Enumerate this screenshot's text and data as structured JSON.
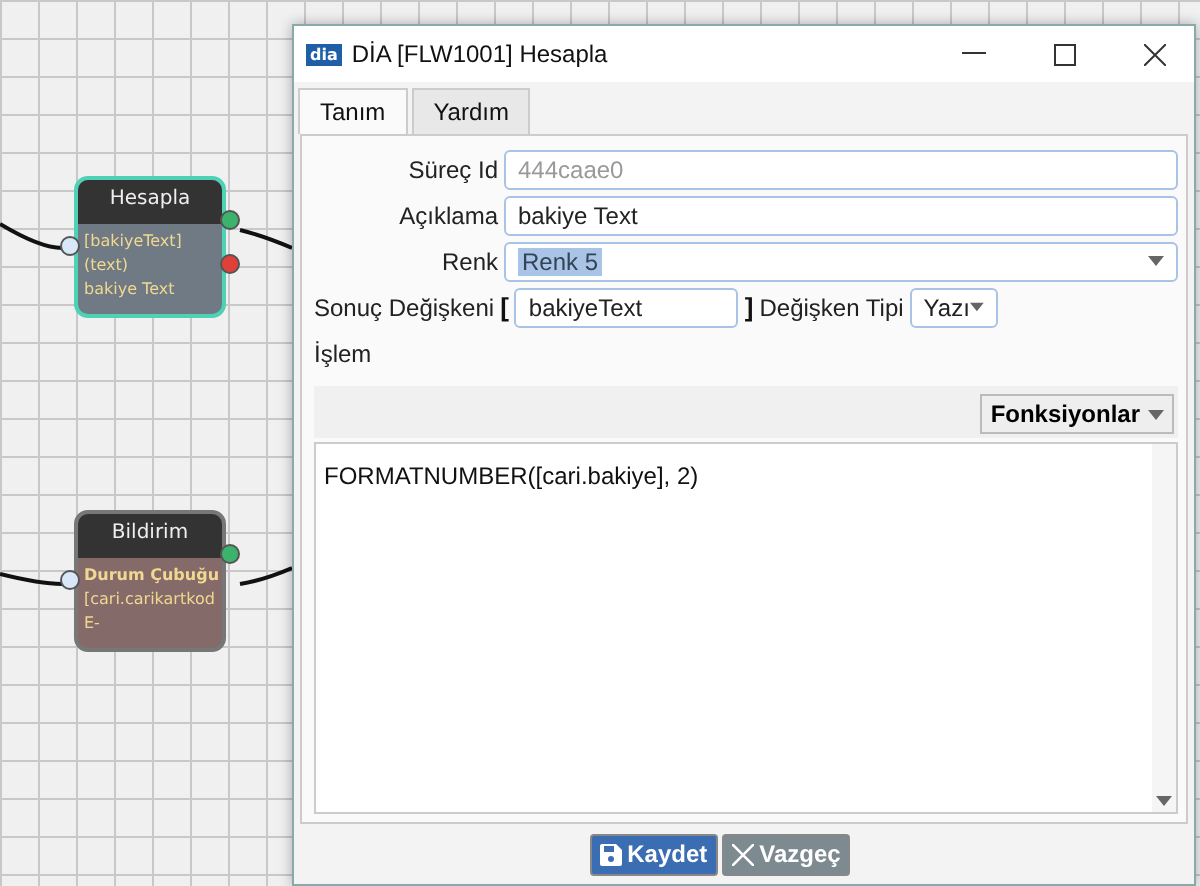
{
  "canvas": {
    "nodes": [
      {
        "title": "Hesapla",
        "color": "#6f7a84",
        "selected": true,
        "lines": [
          "[bakiyeText]",
          "(text)",
          "bakiye Text"
        ],
        "input_port": {
          "color": "#d8e8f8"
        },
        "output_ports": [
          {
            "color": "#3bb36b"
          },
          {
            "color": "#e0403a"
          }
        ]
      },
      {
        "title": "Bildirim",
        "color": "#856a6a",
        "selected": false,
        "lines": [
          "Durum Çubuğu",
          "[cari.carikartkod",
          "E-"
        ],
        "input_port": {
          "color": "#d8e8f8"
        },
        "output_ports": [
          {
            "color": "#3bb36b"
          }
        ]
      }
    ]
  },
  "window": {
    "title": "DİA [FLW1001] Hesapla",
    "logo": "dia"
  },
  "tabs": [
    {
      "label": "Tanım",
      "selected": true
    },
    {
      "label": "Yardım",
      "selected": false
    }
  ],
  "form": {
    "process_id": {
      "label": "Süreç Id",
      "value": "444caae0",
      "disabled": true
    },
    "description": {
      "label": "Açıklama",
      "value": "bakiye Text"
    },
    "color": {
      "label": "Renk",
      "value": "Renk 5"
    },
    "result": {
      "label": "Sonuç Değişkeni",
      "open_bracket": "[",
      "value": "bakiyeText",
      "close_bracket": "]",
      "type_label": "Değişken Tipi",
      "type_value": "Yazı"
    },
    "operation": {
      "label": "İşlem",
      "functions_button": "Fonksiyonlar",
      "formula": "FORMATNUMBER([cari.bakiye], 2)"
    }
  },
  "buttons": [
    {
      "label": "Kaydet",
      "kind": "primary"
    },
    {
      "label": "Vazgeç",
      "kind": "secondary"
    }
  ]
}
